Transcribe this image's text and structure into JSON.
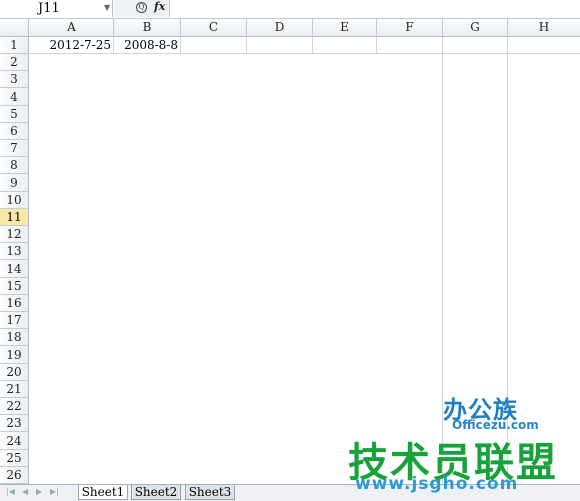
{
  "formula_bar": {
    "name_box": "J11",
    "zoom_icon": "magnifier-icon",
    "fx_label": "fx",
    "formula": ""
  },
  "columns": [
    "A",
    "B",
    "C",
    "D",
    "E",
    "F",
    "G",
    "H"
  ],
  "rows": [
    "1",
    "2",
    "3",
    "4",
    "5",
    "6",
    "7",
    "8",
    "9",
    "10",
    "11",
    "12",
    "13",
    "14",
    "15",
    "16",
    "17",
    "18",
    "19",
    "20",
    "21",
    "22",
    "23",
    "24",
    "25",
    "26"
  ],
  "active_row": "11",
  "cells": {
    "A1": "2012-7-25",
    "B1": "2008-8-8"
  },
  "sheet_tabs": [
    "Sheet1",
    "Sheet2",
    "Sheet3"
  ],
  "active_sheet": "Sheet1",
  "watermark": {
    "logo_top": "办公族",
    "logo_sub": "Officezu.com",
    "logo_main": "技术员联盟",
    "logo_url": "www.jsgho.com"
  }
}
